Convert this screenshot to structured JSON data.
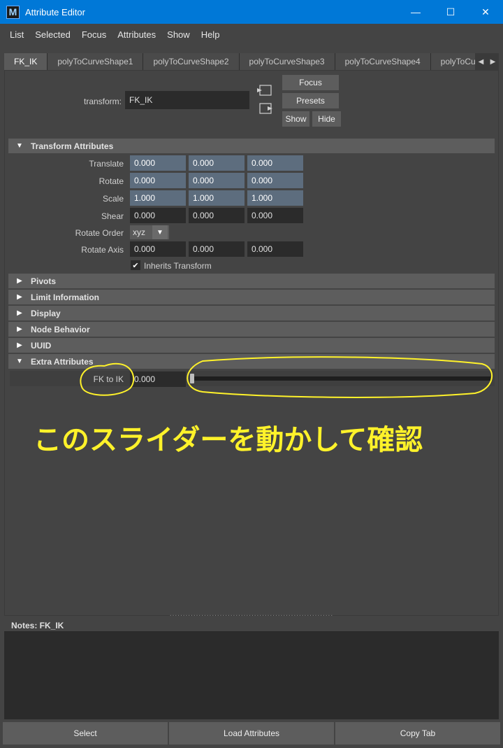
{
  "window": {
    "title": "Attribute Editor",
    "app_icon_letter": "M",
    "minimize": "—",
    "maximize": "☐",
    "close": "✕"
  },
  "menu": [
    "List",
    "Selected",
    "Focus",
    "Attributes",
    "Show",
    "Help"
  ],
  "tabs": [
    "FK_IK",
    "polyToCurveShape1",
    "polyToCurveShape2",
    "polyToCurveShape3",
    "polyToCurveShape4",
    "polyToCur"
  ],
  "header": {
    "transform_label": "transform:",
    "transform_value": "FK_IK",
    "focus_button": "Focus",
    "presets_button": "Presets",
    "show_button": "Show",
    "hide_button": "Hide"
  },
  "transform_attributes": {
    "title": "Transform Attributes",
    "translate": {
      "label": "Translate",
      "x": "0.000",
      "y": "0.000",
      "z": "0.000"
    },
    "rotate": {
      "label": "Rotate",
      "x": "0.000",
      "y": "0.000",
      "z": "0.000"
    },
    "scale": {
      "label": "Scale",
      "x": "1.000",
      "y": "1.000",
      "z": "1.000"
    },
    "shear": {
      "label": "Shear",
      "x": "0.000",
      "y": "0.000",
      "z": "0.000"
    },
    "rotate_order": {
      "label": "Rotate Order",
      "value": "xyz"
    },
    "rotate_axis": {
      "label": "Rotate Axis",
      "x": "0.000",
      "y": "0.000",
      "z": "0.000"
    },
    "inherits_transform": {
      "label": "Inherits Transform",
      "checked": true
    }
  },
  "sections": {
    "pivots": "Pivots",
    "limit_information": "Limit Information",
    "display": "Display",
    "node_behavior": "Node Behavior",
    "uuid": "UUID",
    "extra_attributes": "Extra Attributes"
  },
  "extra": {
    "fk_to_ik_label": "FK to IK",
    "fk_to_ik_value": "0.000",
    "slider_fraction": 0.0
  },
  "annotation": {
    "text": "このスライダーを動かして確認",
    "color": "#fff22a"
  },
  "notes": {
    "label": "Notes:  FK_IK"
  },
  "bottom": {
    "select": "Select",
    "load_attributes": "Load Attributes",
    "copy_tab": "Copy Tab"
  },
  "colors": {
    "titlebar": "#0078d7",
    "background": "#444444",
    "highlight_field": "#5d6d7e"
  }
}
